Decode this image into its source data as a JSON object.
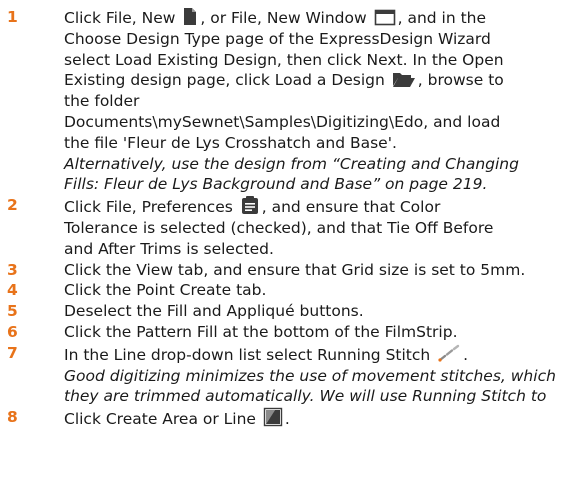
{
  "steps": [
    {
      "number": "1",
      "lines": [
        {
          "parts": [
            {
              "t": "Click File, New "
            },
            {
              "icon": "new-document-icon"
            },
            {
              "t": ", or File, New Window "
            },
            {
              "icon": "new-window-icon"
            },
            {
              "t": ", and in the"
            }
          ]
        },
        {
          "parts": [
            {
              "t": "Choose Design Type page of the ExpressDesign Wizard"
            }
          ]
        },
        {
          "parts": [
            {
              "t": "select Load Existing Design, then click Next. In the Open"
            }
          ]
        },
        {
          "parts": [
            {
              "t": "Existing design page, click Load a Design "
            },
            {
              "icon": "open-folder-icon"
            },
            {
              "t": ", browse to"
            }
          ]
        },
        {
          "parts": [
            {
              "t": "the folder"
            }
          ]
        },
        {
          "parts": [
            {
              "t": "Documents\\mySewnet\\Samples\\Digitizing\\Edo, and load"
            }
          ]
        },
        {
          "parts": [
            {
              "t": "the file 'Fleur de Lys Crosshatch and Base'."
            }
          ]
        }
      ],
      "notes": [
        "Alternatively, use the design from “Creating and Changing",
        "Fills: Fleur de Lys Background and Base” on page 219."
      ]
    },
    {
      "number": "2",
      "lines": [
        {
          "parts": [
            {
              "t": "Click File, Preferences "
            },
            {
              "icon": "preferences-icon"
            },
            {
              "t": ", and ensure that Color"
            }
          ]
        },
        {
          "parts": [
            {
              "t": "Tolerance is selected (checked), and that Tie Off Before"
            }
          ]
        },
        {
          "parts": [
            {
              "t": "and After Trims is selected."
            }
          ]
        }
      ],
      "notes": []
    },
    {
      "number": "3",
      "lines": [
        {
          "parts": [
            {
              "t": "Click the View tab, and ensure that Grid size is set to 5mm."
            }
          ]
        }
      ],
      "notes": []
    },
    {
      "number": "4",
      "lines": [
        {
          "parts": [
            {
              "t": "Click the Point Create tab."
            }
          ]
        }
      ],
      "notes": []
    },
    {
      "number": "5",
      "lines": [
        {
          "parts": [
            {
              "t": "Deselect the Fill and Appliqué buttons."
            }
          ]
        }
      ],
      "notes": []
    },
    {
      "number": "6",
      "lines": [
        {
          "parts": [
            {
              "t": "Click the Pattern Fill at the bottom of the FilmStrip."
            }
          ]
        }
      ],
      "notes": []
    },
    {
      "number": "7",
      "lines": [
        {
          "parts": [
            {
              "t": "In the Line drop-down list select Running Stitch "
            },
            {
              "icon": "running-stitch-icon"
            },
            {
              "t": "."
            }
          ]
        }
      ],
      "notes": [
        "Good digitizing minimizes the use of movement stitches, which",
        "they are trimmed automatically. We will use Running Stitch to"
      ]
    },
    {
      "number": "8",
      "lines": [
        {
          "parts": [
            {
              "t": "Click Create Area or Line "
            },
            {
              "icon": "create-area-line-icon"
            },
            {
              "t": "."
            }
          ]
        }
      ],
      "notes": []
    }
  ]
}
